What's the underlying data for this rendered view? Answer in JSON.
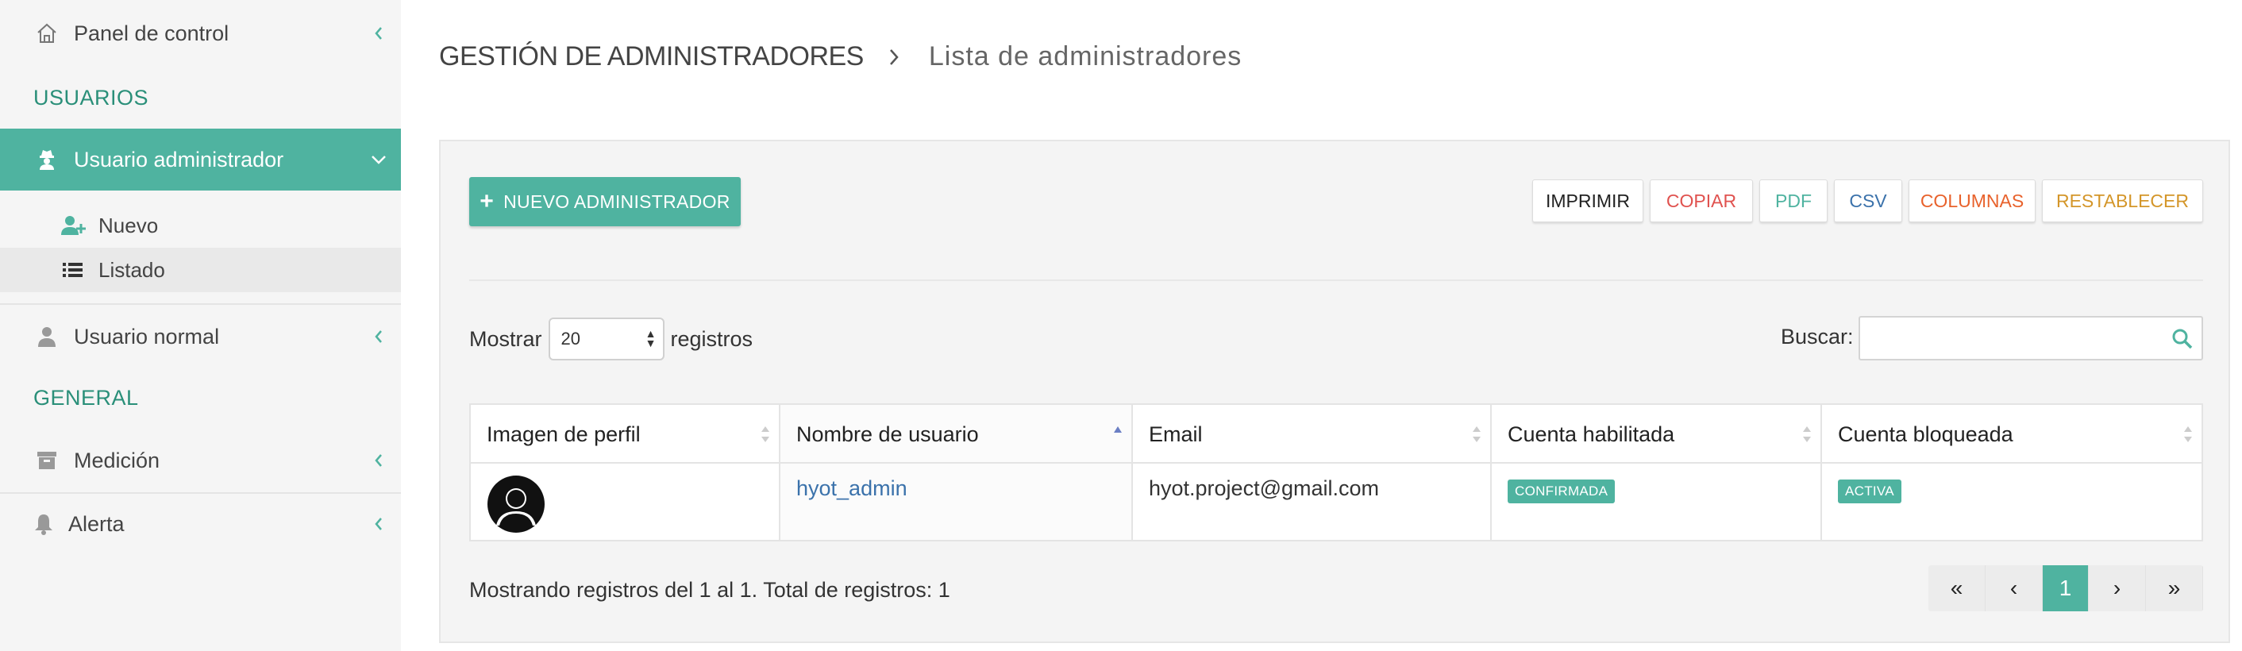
{
  "sidebar": {
    "panel": "Panel de control",
    "section_users": "USUARIOS",
    "admin_user": "Usuario administrador",
    "sub_new": "Nuevo",
    "sub_list": "Listado",
    "normal_user": "Usuario normal",
    "section_general": "GENERAL",
    "measure": "Medición",
    "alert": "Alerta"
  },
  "breadcrumb": {
    "section": "GESTIÓN DE ADMINISTRADORES",
    "page": "Lista de administradores"
  },
  "toolbar": {
    "new_admin": "NUEVO ADMINISTRADOR",
    "print": "IMPRIMIR",
    "copy": "COPIAR",
    "pdf": "PDF",
    "csv": "CSV",
    "columns": "COLUMNAS",
    "reset": "RESTABLECER"
  },
  "controls": {
    "show_label": "Mostrar",
    "page_size": "20",
    "records_label": "registros",
    "search_label": "Buscar:",
    "search_value": ""
  },
  "table": {
    "headers": [
      "Imagen de perfil",
      "Nombre de usuario",
      "Email",
      "Cuenta habilitada",
      "Cuenta bloqueada"
    ],
    "rows": [
      {
        "username": "hyot_admin",
        "email": "hyot.project@gmail.com",
        "enabled": "CONFIRMADA",
        "locked": "ACTIVA"
      }
    ]
  },
  "footer": {
    "info": "Mostrando registros del 1 al 1. Total de registros: 1",
    "pages": {
      "first": "«",
      "prev": "‹",
      "current": "1",
      "next": "›",
      "last": "»"
    }
  },
  "colors": {
    "accent": "#4fb3a0",
    "copy": "#e0524f",
    "pdf": "#4fb3a0",
    "csv": "#3b72ab",
    "columns": "#e8622c",
    "reset": "#d4962a",
    "link": "#3b72ab"
  }
}
